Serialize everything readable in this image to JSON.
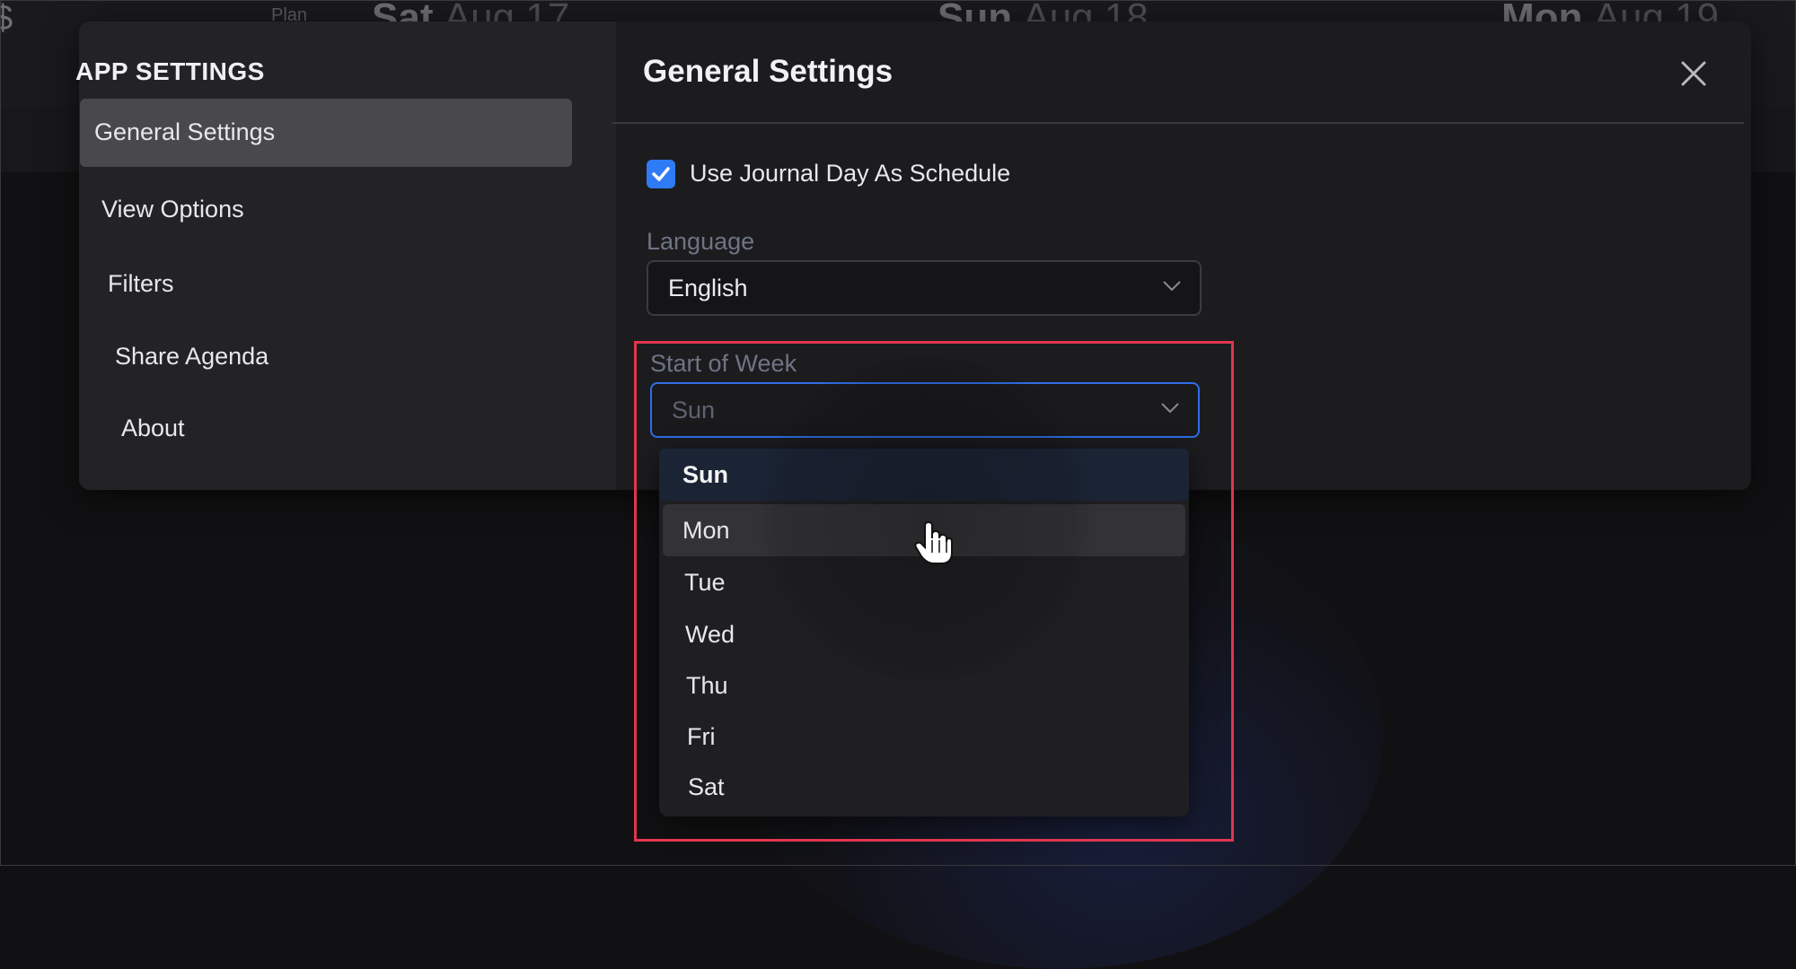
{
  "background": {
    "edge_glyph": "$",
    "plan_label": "Plan",
    "dates": [
      {
        "day": "Sat",
        "date": "Aug 17"
      },
      {
        "day": "Sun",
        "date": "Aug 18"
      },
      {
        "day": "Mon",
        "date": "Aug 19"
      }
    ]
  },
  "sidebar": {
    "title": "APP SETTINGS",
    "items": [
      {
        "label": "General Settings",
        "active": true
      },
      {
        "label": "View Options"
      },
      {
        "label": "Filters"
      },
      {
        "label": "Share Agenda"
      },
      {
        "label": "About"
      }
    ]
  },
  "content": {
    "title": "General Settings",
    "close_icon": "close-icon",
    "journal_checkbox": {
      "label": "Use Journal Day As Schedule",
      "checked": true
    },
    "language": {
      "label": "Language",
      "value": "English"
    },
    "start_of_week": {
      "label": "Start of Week",
      "value": "Sun",
      "options": [
        "Sun",
        "Mon",
        "Tue",
        "Wed",
        "Thu",
        "Fri",
        "Sat"
      ],
      "selected": "Sun",
      "hovered": "Mon"
    }
  },
  "colors": {
    "accent": "#2f7bf5",
    "highlight": "#e0364f"
  }
}
